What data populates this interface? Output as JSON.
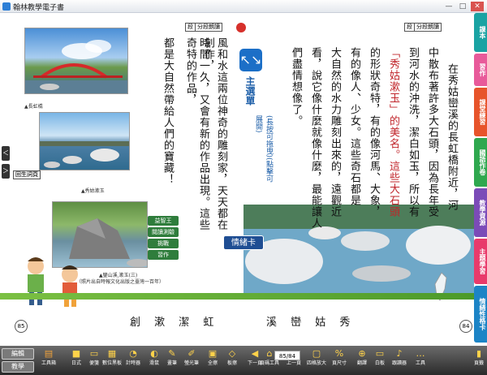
{
  "window": {
    "title": "翰林教學電子書",
    "minimize": "—",
    "maximize": "□",
    "close": "✕"
  },
  "left_page": {
    "number": "85",
    "section_tag_1": "段",
    "section_tag_2": "分段朗讀",
    "caption_1": "▲長虹橋",
    "caption_2": "▲秀姑漱玉",
    "caption_3": "▲鑾山溪,漱玉(三)",
    "caption_4": "（照片出自時報文化出版之臺灣一百年）",
    "nav_back": "＜",
    "nav_forward": "＞",
    "back_link": "回生詞頁",
    "text_cols": [
      "風和水這兩位神奇的雕刻家，天天都在創作，",
      "時間一久，又會有新的作品出現。這些奇特的作品，",
      "都是大自然帶給人們的寶藏！"
    ],
    "float_menu": [
      "益智王",
      "閱讀測驗",
      "挑戰",
      "習作"
    ]
  },
  "main_menu": {
    "icon": "↖↘",
    "label": "主選單",
    "hint": "(長按可拖曳)(點擊可展開)"
  },
  "emotion_card": "情緒卡",
  "right_page": {
    "number": "84",
    "section_tag_1": "段",
    "section_tag_2": "分段朗讀",
    "text_cols": [
      "在秀姑巒溪的長虹橋附近，河",
      "中散布著許多大石頭，因為長年受",
      "到河水的沖洗，潔白如玉，所以有",
      "「秀姑漱玉」的美名。這些大石頭",
      "的形狀奇特，有的像河馬、大象，",
      "有的像人、少女。這些奇石都是",
      "大自然的水力雕刻出來的，遠觀近",
      "看，說它像什麼就像什麼，最能讓人",
      "們盡情想像了。"
    ]
  },
  "vocab_left": [
    "創",
    "漱",
    "潔",
    "虹"
  ],
  "vocab_right": [
    "溪",
    "巒",
    "姑",
    "秀"
  ],
  "right_tabs": [
    {
      "label": "課本",
      "color": "#1aa3a3"
    },
    {
      "label": "習作",
      "color": "#e85a9a"
    },
    {
      "label": "課堂練習",
      "color": "#e7542b"
    },
    {
      "label": "國語作卷",
      "color": "#2fa84f"
    },
    {
      "label": "教學資源",
      "color": "#7b4bb8"
    },
    {
      "label": "主題學習",
      "color": "#e83a6b"
    },
    {
      "label": "情緒性格卡",
      "color": "#1c84c6"
    }
  ],
  "toolbar": {
    "edit_label": "編輯",
    "teach_label": "教學",
    "toolbox_label": "工具箱",
    "items": [
      {
        "label": "日式",
        "icon": "■"
      },
      {
        "label": "便箋",
        "icon": "▭"
      },
      {
        "label": "數位黑板",
        "icon": "▦"
      },
      {
        "label": "計時器",
        "icon": "◔"
      },
      {
        "label": "滑鼠",
        "icon": "◐"
      },
      {
        "label": "畫筆",
        "icon": "✎"
      },
      {
        "label": "螢光筆",
        "icon": "✐"
      },
      {
        "label": "全擦",
        "icon": "▣"
      },
      {
        "label": "板擦",
        "icon": "◇"
      },
      {
        "label": "下一頁",
        "icon": "◀"
      },
      {
        "label": "頁碼工具",
        "icon": "⌂"
      },
      {
        "label": "上一頁",
        "icon": "▶"
      },
      {
        "label": "四格放大",
        "icon": "▢"
      },
      {
        "label": "頁尺寸",
        "icon": "%"
      },
      {
        "label": "翻譯",
        "icon": "⊕"
      },
      {
        "label": "白板",
        "icon": "▭"
      },
      {
        "label": "跟讀器",
        "icon": "♪"
      },
      {
        "label": "工具",
        "icon": "…"
      },
      {
        "label": "頁籤",
        "icon": "▮"
      }
    ],
    "page_value": "85/84"
  }
}
